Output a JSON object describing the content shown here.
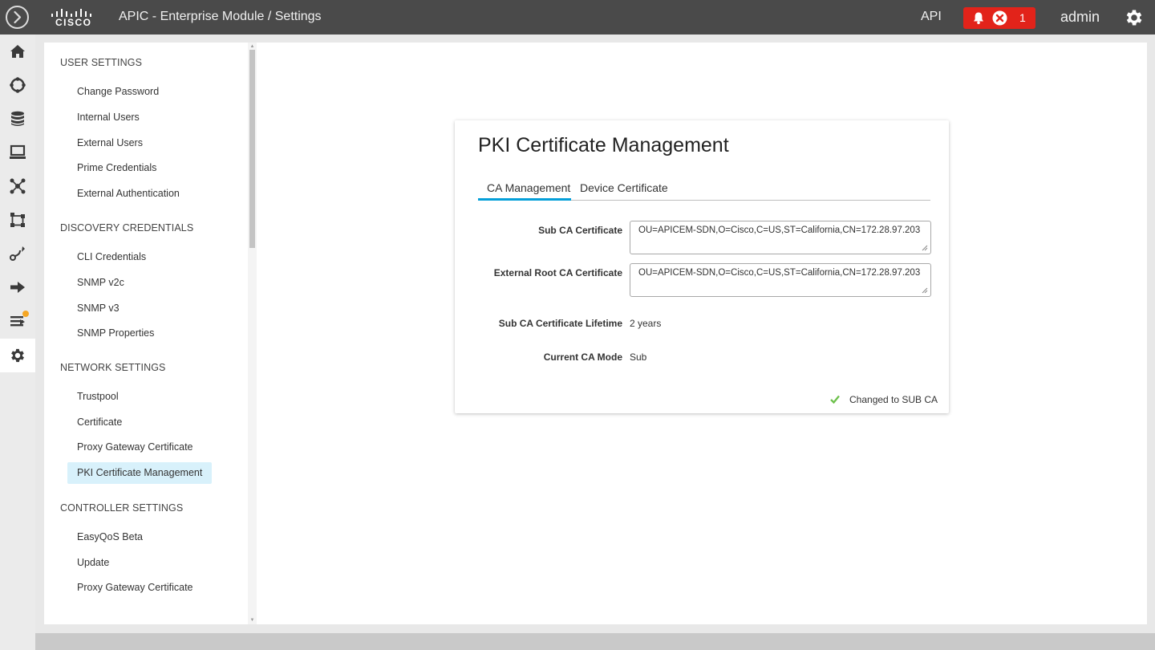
{
  "header": {
    "title": "APIC - Enterprise Module / Settings",
    "logo_text": "cisco",
    "api_label": "API",
    "alert_count": "1",
    "username": "admin",
    "alert_color": "#e2231a"
  },
  "rail": {
    "items": [
      "home-icon",
      "discovery-icon",
      "database-icon",
      "devices-icon",
      "topology-icon",
      "network-icon",
      "path-icon",
      "forward-icon",
      "policy-icon",
      "settings-icon"
    ]
  },
  "nav": {
    "sections": [
      {
        "title": "USER SETTINGS",
        "items": [
          "Change Password",
          "Internal Users",
          "External Users",
          "Prime Credentials",
          "External Authentication"
        ]
      },
      {
        "title": "DISCOVERY CREDENTIALS",
        "items": [
          "CLI Credentials",
          "SNMP v2c",
          "SNMP v3",
          "SNMP Properties"
        ]
      },
      {
        "title": "NETWORK SETTINGS",
        "items": [
          "Trustpool",
          "Certificate",
          "Proxy Gateway Certificate",
          "PKI Certificate Management"
        ]
      },
      {
        "title": "CONTROLLER SETTINGS",
        "items": [
          "EasyQoS Beta",
          "Update",
          "Proxy Gateway Certificate"
        ]
      }
    ],
    "active_item": "PKI Certificate Management"
  },
  "card": {
    "title": "PKI Certificate Management",
    "tabs": [
      {
        "label": "CA Management",
        "active": true
      },
      {
        "label": "Device Certificate",
        "active": false
      }
    ],
    "fields": [
      {
        "label": "Sub CA Certificate",
        "value": "OU=APICEM-SDN,O=Cisco,C=US,ST=California,CN=172.28.97.203"
      },
      {
        "label": "External Root CA Certificate",
        "value": "OU=APICEM-SDN,O=Cisco,C=US,ST=California,CN=172.28.97.203"
      }
    ],
    "lifetime": {
      "label": "Sub CA Certificate Lifetime",
      "value": "2 years"
    },
    "mode": {
      "label": "Current CA Mode",
      "value": "Sub"
    },
    "status": "Changed to SUB CA",
    "accent_color": "#049fd9",
    "success_color": "#6cc04a"
  }
}
